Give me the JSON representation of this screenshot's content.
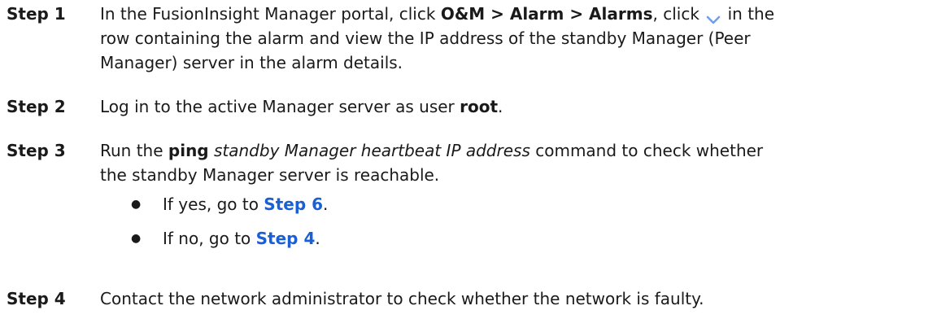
{
  "step1": {
    "label": "Step 1",
    "l1_a": "In the FusionInsight Manager portal, click ",
    "l1_b": "O&M > Alarm > Alarms",
    "l1_c": ", click ",
    "l1_d": " in the",
    "l2": "row containing the alarm and view the IP address of the standby Manager (Peer",
    "l3": "Manager) server in the alarm details.",
    "chevron_icon": "chevron-down-icon",
    "chevron_color": "#6fa0e8"
  },
  "step2": {
    "label": "Step 2",
    "l1_a": "Log in to the active Manager server as user ",
    "l1_b": "root",
    "l1_c": "."
  },
  "step3": {
    "label": "Step 3",
    "l1_a": "Run the ",
    "l1_b": "ping",
    "l1_c": " ",
    "l1_d": "standby Manager heartbeat IP address",
    "l1_e": " command to check whether",
    "l2": "the standby Manager server is reachable.",
    "bullets": [
      {
        "prefix": "If yes, go to ",
        "link": "Step 6",
        "suffix": "."
      },
      {
        "prefix": "If no, go to ",
        "link": "Step 4",
        "suffix": "."
      }
    ],
    "bullet_char": "●"
  },
  "step4": {
    "label": "Step 4",
    "l1": "Contact the network administrator to check whether the network is faulty."
  },
  "colors": {
    "text": "#1a1a1a",
    "link": "#1a5fd6"
  }
}
